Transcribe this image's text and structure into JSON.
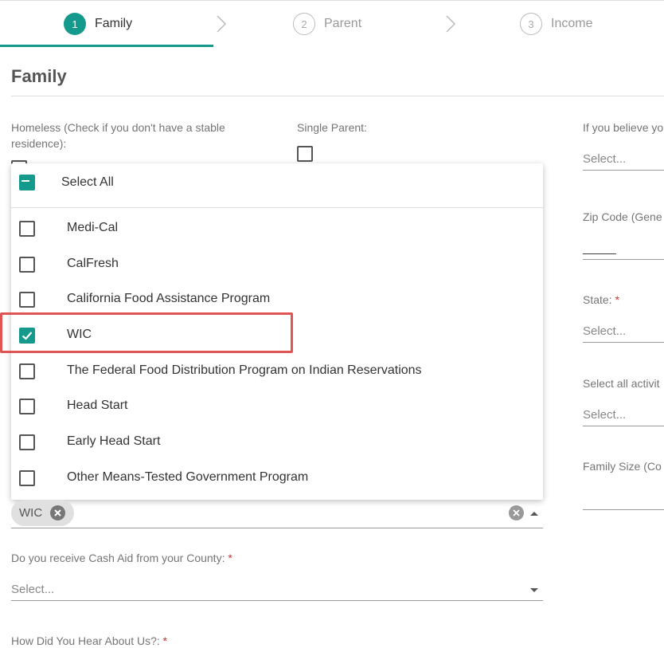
{
  "stepper": {
    "steps": [
      {
        "number": "1",
        "label": "Family",
        "state": "active"
      },
      {
        "number": "2",
        "label": "Parent",
        "state": "inactive"
      },
      {
        "number": "3",
        "label": "Income",
        "state": "inactive"
      }
    ]
  },
  "page": {
    "title": "Family"
  },
  "left_fields": {
    "homeless_label": "Homeless (Check if you don't have a stable residence):",
    "single_parent_label": "Single Parent:"
  },
  "right_fields": {
    "believe_label": "If you believe yo",
    "believe_placeholder": "Select...",
    "zip_label": "Zip Code (Gene",
    "zip_value": "_____",
    "state_label": "State:",
    "state_placeholder": "Select...",
    "activities_label": "Select all activit",
    "activities_placeholder": "Select...",
    "family_size_label": "Family Size (Co"
  },
  "dropdown": {
    "select_all_label": "Select All",
    "options": [
      {
        "label": "Medi-Cal",
        "checked": false
      },
      {
        "label": "CalFresh",
        "checked": false
      },
      {
        "label": "California Food Assistance Program",
        "checked": false
      },
      {
        "label": "WIC",
        "checked": true
      },
      {
        "label": "The Federal Food Distribution Program on Indian Reservations",
        "checked": false
      },
      {
        "label": "Head Start",
        "checked": false
      },
      {
        "label": "Early Head Start",
        "checked": false
      },
      {
        "label": "Other Means-Tested Government Program",
        "checked": false
      }
    ]
  },
  "selected_chips": [
    "WIC"
  ],
  "cash_aid": {
    "label": "Do you receive Cash Aid from your County:",
    "required_mark": "*",
    "placeholder": "Select..."
  },
  "hear_about": {
    "label": "How Did You Hear About Us?:",
    "required_mark": "*"
  },
  "colors": {
    "accent": "#139a8c",
    "highlight": "#e05454",
    "required": "#d32f2f"
  }
}
